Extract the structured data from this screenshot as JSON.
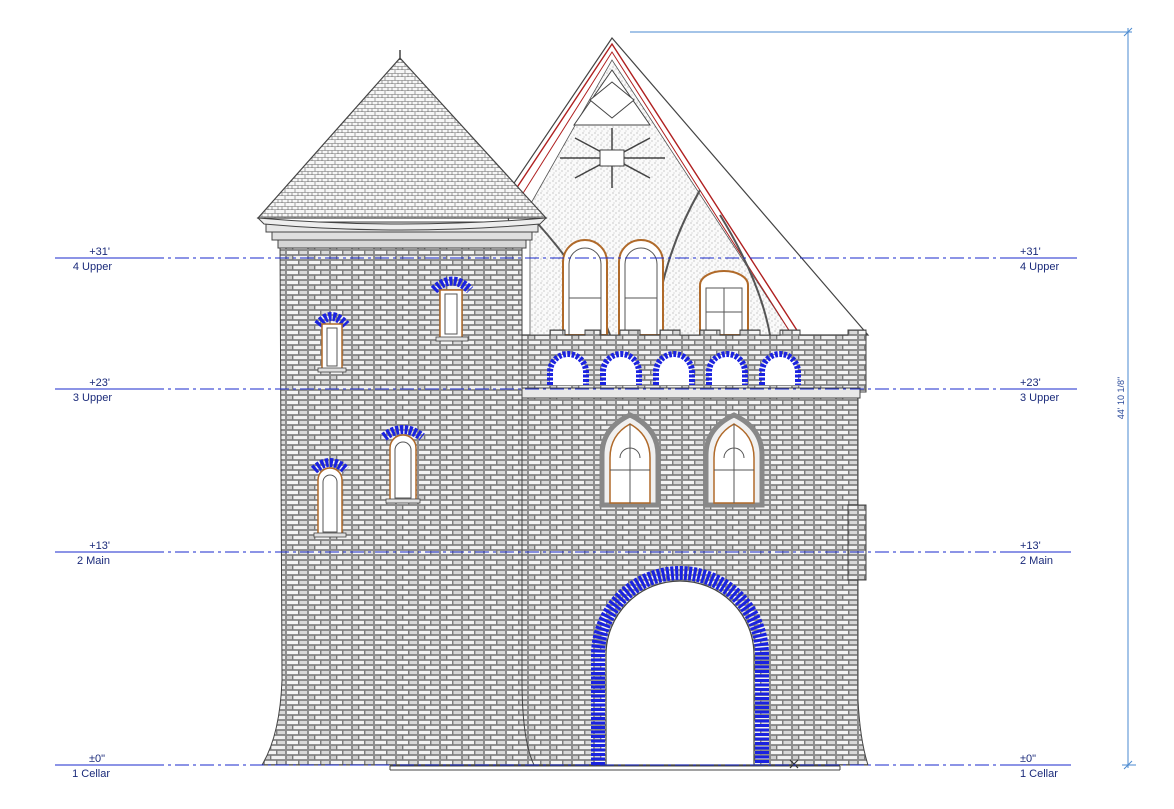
{
  "drawing": {
    "levels": [
      {
        "elevation": "+31'",
        "name": "4 Upper"
      },
      {
        "elevation": "+23'",
        "name": "3 Upper"
      },
      {
        "elevation": "+13'",
        "name": "2 Main"
      },
      {
        "elevation": "±0\"",
        "name": "1 Cellar"
      }
    ],
    "overall_height": "44' 10 1/8\"",
    "colors": {
      "level_line": "#1a2acc",
      "dimension": "#4a8ad0",
      "stone": "#555555",
      "brick_accent": "#1a22e0",
      "rafter": "#b02020",
      "window_frame": "#b06a2a"
    }
  }
}
